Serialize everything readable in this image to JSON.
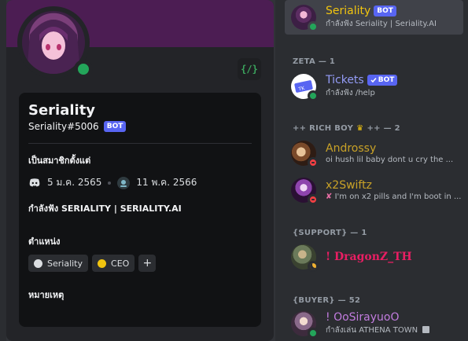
{
  "profile": {
    "username": "Seriality",
    "tag": "Seriality#5006",
    "bot_label": "BOT",
    "dev_badge_glyph": "{/}",
    "member_since_title": "เป็นสมาชิกตั้งแต่",
    "discord_since": "5 ม.ค. 2565",
    "server_since": "11 พ.ค. 2566",
    "activity": "กำลังฟัง SERIALITY | SERIALITY.AI",
    "roles_title": "ตำแหน่ง",
    "roles": [
      {
        "label": "Seriality",
        "color": "#dbdee1"
      },
      {
        "label": "CEO",
        "color": "#f1c40f"
      }
    ],
    "add_role_glyph": "+",
    "note_title": "หมายเหตุ"
  },
  "members": {
    "top": {
      "name": "Seriality",
      "badge": "BOT",
      "activity": "กำลังฟัง Seriality | Seriality.AI",
      "name_color": "#f1c40f"
    },
    "groups": {
      "zeta": "ZETA — 1",
      "rich_boy_prefix": "++ RICH BOY",
      "rich_boy_suffix": "++ — 2",
      "support": "{SUPPORT} — 1",
      "buyer": "{BUYER} — 52"
    },
    "tickets": {
      "name": "Tickets",
      "badge": "BOT",
      "activity": "กำลังฟัง /help",
      "name_color": "#949cf7"
    },
    "androssy": {
      "name": "Androssy",
      "activity": "oi hush lil baby dont u cry the ...",
      "name_color": "#c9a227"
    },
    "x2swiftz": {
      "name": "x2Swiftz",
      "activity": "I'm on x2 pills and I'm boot in ...",
      "name_color": "#c9a227"
    },
    "dragonz": {
      "name": "! DragonZ_TH",
      "name_color": "#e91e63"
    },
    "oosira": {
      "name": "! OoSirayuoO",
      "activity": "กำลังเล่น ATHENA TOWN",
      "name_color": "#c27cdf"
    }
  }
}
